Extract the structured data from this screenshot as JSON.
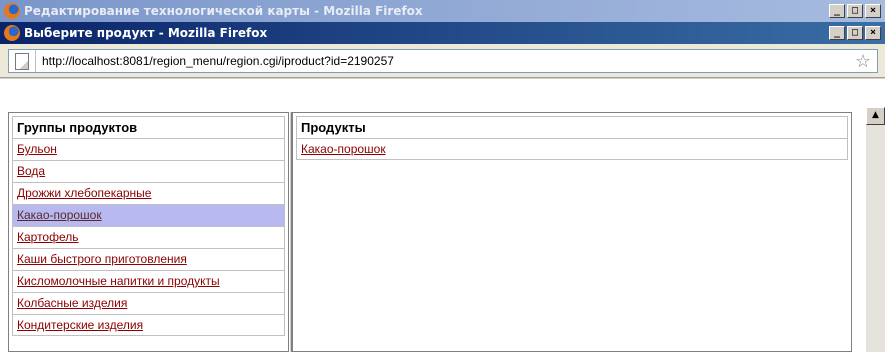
{
  "outer_window": {
    "title": "Редактирование технологической карты - Mozilla Firefox",
    "controls": [
      "_",
      "□",
      "×"
    ]
  },
  "inner_window": {
    "title": "Выберите продукт - Mozilla Firefox",
    "controls": [
      "_",
      "□",
      "×"
    ]
  },
  "address_bar": {
    "url": "http://localhost:8081/region_menu/region.cgi/iproduct?id=2190257",
    "icon": "page-icon",
    "bookmark_icon": "star-icon"
  },
  "left_panel": {
    "header": "Группы продуктов",
    "items": [
      "Бульон",
      "Вода",
      "Дрожжи хлебопекарные",
      "Какао-порошок",
      "Картофель",
      "Каши быстрого приготовления",
      "Кисломолочные напитки и продукты",
      "Колбасные изделия",
      "Кондитерские изделия"
    ],
    "selected_item": "Какао-порошок"
  },
  "right_panel": {
    "header": "Продукты",
    "items": [
      "Какао-порошок"
    ]
  },
  "colors": {
    "link": "#8b0000",
    "selected_row": "#b7b9f0",
    "active_title": "#0a246a"
  }
}
